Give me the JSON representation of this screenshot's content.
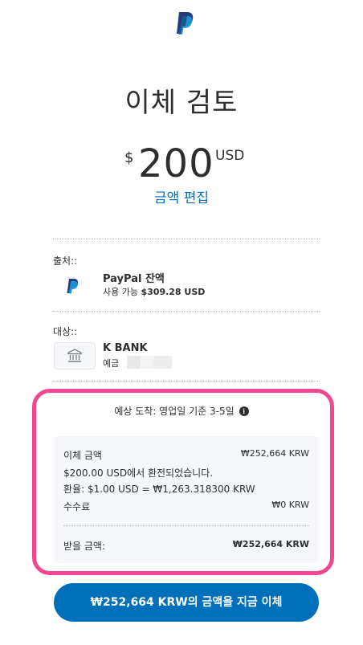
{
  "colors": {
    "primary": "#0070ba",
    "highlight": "#f0478e",
    "text": "#2c2e2f",
    "panel": "#f5f7fa"
  },
  "header": {
    "logo_icon": "paypal-logo-icon",
    "title": "이체 검토"
  },
  "amount": {
    "symbol": "$",
    "value": "200",
    "currency": "USD",
    "edit_label": "금액 편집"
  },
  "source": {
    "label": "출처::",
    "icon": "paypal-logo-icon",
    "name": "PayPal 잔액",
    "balance_prefix": "사용 가능 ",
    "balance_value": "$309.28 USD"
  },
  "destination": {
    "label": "대상::",
    "icon": "bank-icon",
    "name": "K BANK",
    "account_type": "예금"
  },
  "summary": {
    "eta": "예상 도착: 영업일 기준 3-5일",
    "info_icon": "info-icon",
    "transfer_label": "이체 금액",
    "transfer_value": "₩252,664 KRW",
    "conversion_note": "$200.00 USD에서 환전되었습니다.",
    "exchange_rate": "환율: $1.00 USD = ₩1,263.318300 KRW",
    "fee_label": "수수료",
    "fee_value": "₩0 KRW",
    "receive_label": "받을 금액:",
    "receive_value": "₩252,664 KRW"
  },
  "cta": {
    "amount": "₩252,664 KRW",
    "suffix": "의 금액을 지금 이체"
  }
}
